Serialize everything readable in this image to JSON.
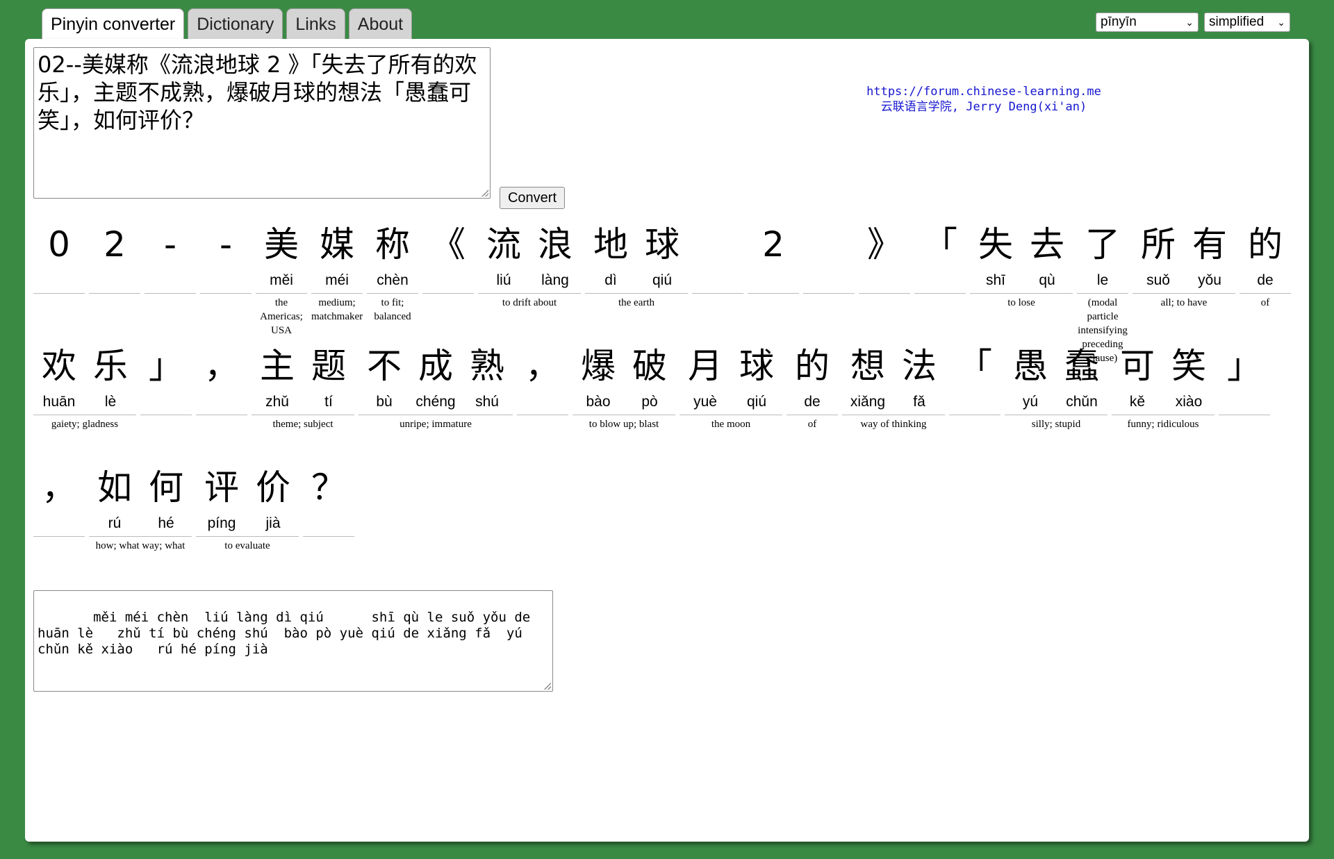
{
  "tabs": [
    {
      "label": "Pinyin converter",
      "active": true
    },
    {
      "label": "Dictionary",
      "active": false
    },
    {
      "label": "Links",
      "active": false
    },
    {
      "label": "About",
      "active": false
    }
  ],
  "selects": {
    "tone_mode": "pīnyīn",
    "script": "simplified"
  },
  "input_text": "02--美媒称《流浪地球 2 》「失去了所有的欢乐」，主题不成熟，爆破月球的想法「愚蠢可笑」，如何评价？",
  "convert_label": "Convert",
  "credit": {
    "line1": "https://forum.chinese-learning.me",
    "line2": "云联语言学院, Jerry Deng(xi'an)"
  },
  "rows": [
    [
      {
        "chars": [
          {
            "h": "0",
            "p": ""
          }
        ],
        "def": ""
      },
      {
        "chars": [
          {
            "h": "2",
            "p": ""
          }
        ],
        "def": ""
      },
      {
        "chars": [
          {
            "h": "-",
            "p": ""
          }
        ],
        "def": ""
      },
      {
        "chars": [
          {
            "h": "-",
            "p": ""
          }
        ],
        "def": ""
      },
      {
        "chars": [
          {
            "h": "美",
            "p": "měi"
          }
        ],
        "def": "the Americas; USA"
      },
      {
        "chars": [
          {
            "h": "媒",
            "p": "méi"
          }
        ],
        "def": "medium; matchmaker"
      },
      {
        "chars": [
          {
            "h": "称",
            "p": "chèn"
          }
        ],
        "def": "to fit; balanced"
      },
      {
        "chars": [
          {
            "h": "《",
            "p": ""
          }
        ],
        "def": ""
      },
      {
        "chars": [
          {
            "h": "流",
            "p": "liú"
          },
          {
            "h": "浪",
            "p": "làng"
          }
        ],
        "def": "to drift about"
      },
      {
        "chars": [
          {
            "h": "地",
            "p": "dì"
          },
          {
            "h": "球",
            "p": "qiú"
          }
        ],
        "def": "the earth"
      },
      {
        "chars": [
          {
            "h": "",
            "p": ""
          }
        ],
        "def": ""
      },
      {
        "chars": [
          {
            "h": "2",
            "p": ""
          }
        ],
        "def": ""
      },
      {
        "chars": [
          {
            "h": "",
            "p": ""
          }
        ],
        "def": ""
      },
      {
        "chars": [
          {
            "h": "》",
            "p": ""
          }
        ],
        "def": ""
      },
      {
        "chars": [
          {
            "h": "「",
            "p": ""
          }
        ],
        "def": ""
      },
      {
        "chars": [
          {
            "h": "失",
            "p": "shī"
          },
          {
            "h": "去",
            "p": "qù"
          }
        ],
        "def": "to lose"
      },
      {
        "chars": [
          {
            "h": "了",
            "p": "le"
          }
        ],
        "def": "(modal particle intensifying preceding clause)"
      },
      {
        "chars": [
          {
            "h": "所",
            "p": "suǒ"
          },
          {
            "h": "有",
            "p": "yǒu"
          }
        ],
        "def": "all; to have"
      },
      {
        "chars": [
          {
            "h": "的",
            "p": "de"
          }
        ],
        "def": "of"
      }
    ],
    [
      {
        "chars": [
          {
            "h": "欢",
            "p": "huān"
          },
          {
            "h": "乐",
            "p": "lè"
          }
        ],
        "def": "gaiety; gladness"
      },
      {
        "chars": [
          {
            "h": "」",
            "p": ""
          }
        ],
        "def": ""
      },
      {
        "chars": [
          {
            "h": "，",
            "p": ""
          }
        ],
        "def": ""
      },
      {
        "chars": [
          {
            "h": "主",
            "p": "zhǔ"
          },
          {
            "h": "题",
            "p": "tí"
          }
        ],
        "def": "theme; subject"
      },
      {
        "chars": [
          {
            "h": "不",
            "p": "bù"
          },
          {
            "h": "成",
            "p": "chéng"
          },
          {
            "h": "熟",
            "p": "shú"
          }
        ],
        "def": "unripe; immature"
      },
      {
        "chars": [
          {
            "h": "，",
            "p": ""
          }
        ],
        "def": ""
      },
      {
        "chars": [
          {
            "h": "爆",
            "p": "bào"
          },
          {
            "h": "破",
            "p": "pò"
          }
        ],
        "def": "to blow up; blast"
      },
      {
        "chars": [
          {
            "h": "月",
            "p": "yuè"
          },
          {
            "h": "球",
            "p": "qiú"
          }
        ],
        "def": "the moon"
      },
      {
        "chars": [
          {
            "h": "的",
            "p": "de"
          }
        ],
        "def": "of"
      },
      {
        "chars": [
          {
            "h": "想",
            "p": "xiǎng"
          },
          {
            "h": "法",
            "p": "fǎ"
          }
        ],
        "def": "way of thinking"
      },
      {
        "chars": [
          {
            "h": "「",
            "p": ""
          }
        ],
        "def": ""
      },
      {
        "chars": [
          {
            "h": "愚",
            "p": "yú"
          },
          {
            "h": "蠢",
            "p": "chǔn"
          }
        ],
        "def": "silly; stupid"
      },
      {
        "chars": [
          {
            "h": "可",
            "p": "kě"
          },
          {
            "h": "笑",
            "p": "xiào"
          }
        ],
        "def": "funny; ridiculous"
      },
      {
        "chars": [
          {
            "h": "」",
            "p": ""
          }
        ],
        "def": ""
      }
    ],
    [
      {
        "chars": [
          {
            "h": "，",
            "p": ""
          }
        ],
        "def": ""
      },
      {
        "chars": [
          {
            "h": "如",
            "p": "rú"
          },
          {
            "h": "何",
            "p": "hé"
          }
        ],
        "def": "how; what way; what"
      },
      {
        "chars": [
          {
            "h": "评",
            "p": "píng"
          },
          {
            "h": "价",
            "p": "jià"
          }
        ],
        "def": "to evaluate"
      },
      {
        "chars": [
          {
            "h": "？",
            "p": ""
          }
        ],
        "def": ""
      }
    ]
  ],
  "output_text": "   měi méi chèn  liú làng dì qiú      shī qù le suǒ yǒu de huān lè   zhǔ tí bù chéng shú  bào pò yuè qiú de xiǎng fǎ  yú chǔn kě xiào   rú hé píng jià"
}
